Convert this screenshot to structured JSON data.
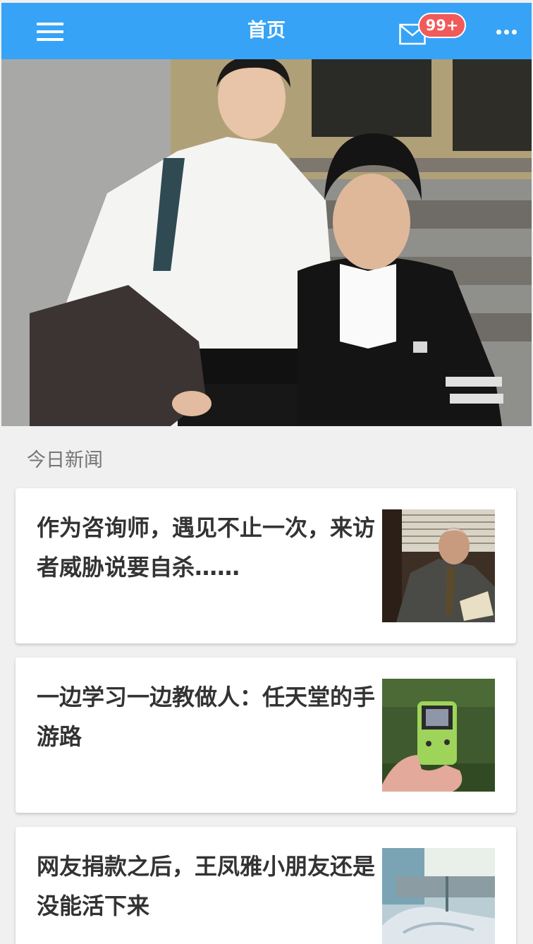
{
  "header": {
    "title": "首页",
    "badge_count": "99+",
    "menu_icon": "hamburger-menu-icon",
    "mail_icon": "envelope-icon",
    "more_icon": "more-dots-icon",
    "accent_color": "#36a3f7",
    "badge_color": "#f15a5a"
  },
  "hero": {
    "image": "woman-and-boy-photo"
  },
  "section": {
    "label": "今日新闻"
  },
  "news": [
    {
      "title": "作为咨询师，遇见不止一次，来访者威胁说要自杀……",
      "thumb": "elderly-man-in-office-photo"
    },
    {
      "title": "一边学习一边教做人：任天堂的手游路",
      "thumb": "hand-holding-gameboy-photo"
    },
    {
      "title": "网友捐款之后，王凤雅小朋友还是没能活下来",
      "thumb": "hospital-bed-photo"
    }
  ]
}
